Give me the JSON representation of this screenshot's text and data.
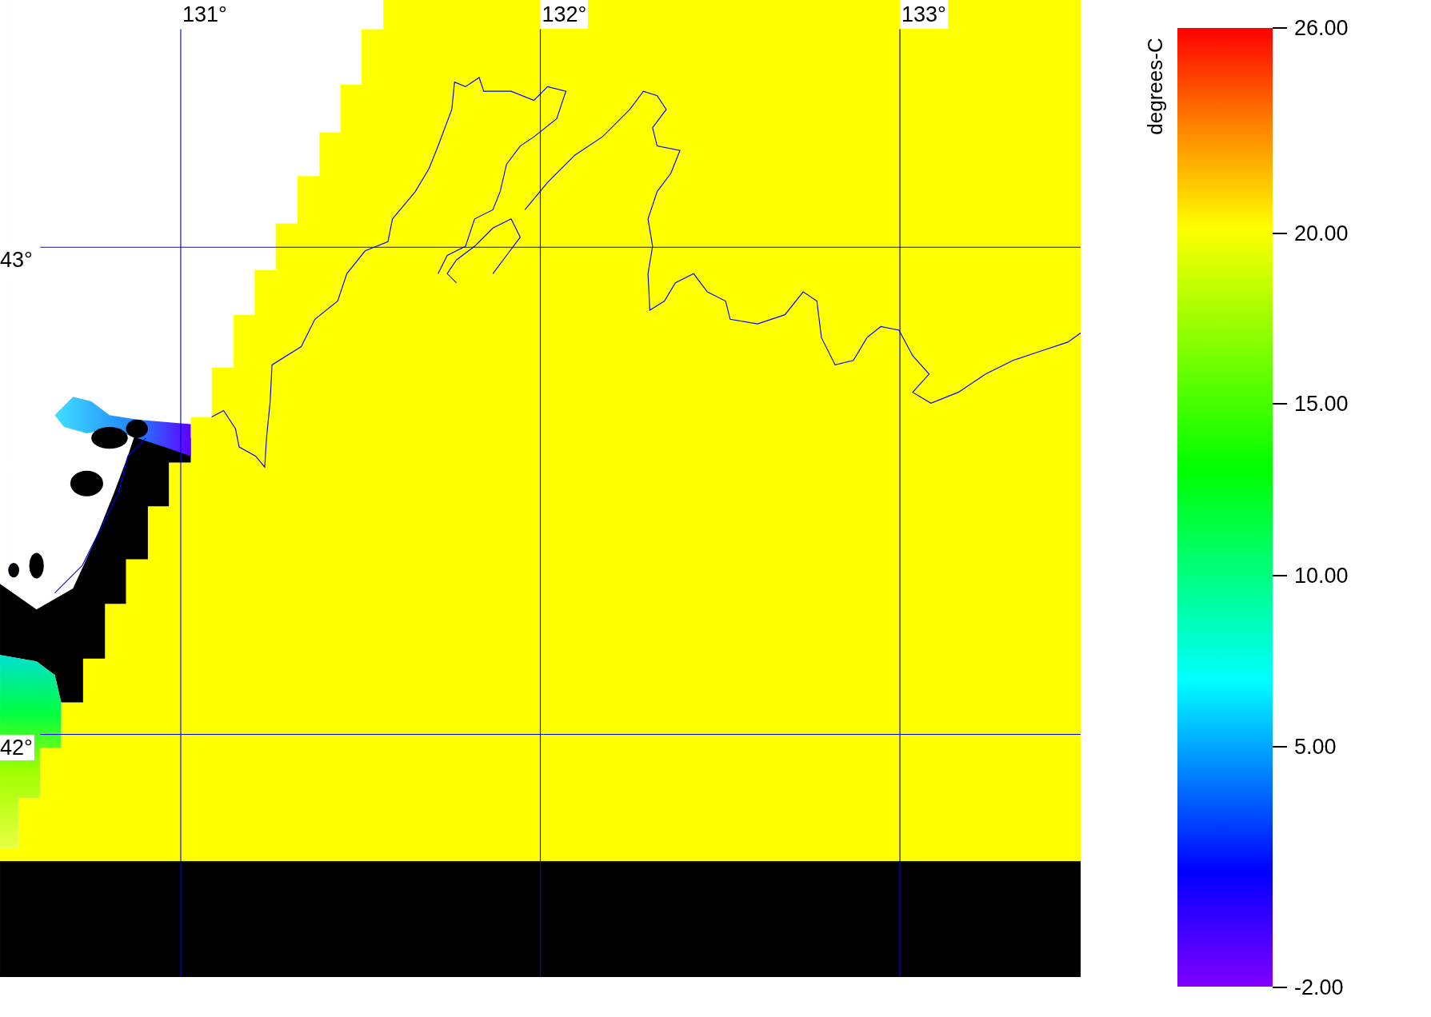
{
  "map": {
    "longitude_labels": [
      "131°",
      "132°",
      "133°"
    ],
    "latitude_labels": [
      "43°",
      "42°"
    ]
  },
  "colorbar": {
    "units": "degrees-C",
    "ticks": [
      "26.00",
      "20.00",
      "15.00",
      "10.00",
      "5.00",
      "-2.00"
    ]
  }
}
